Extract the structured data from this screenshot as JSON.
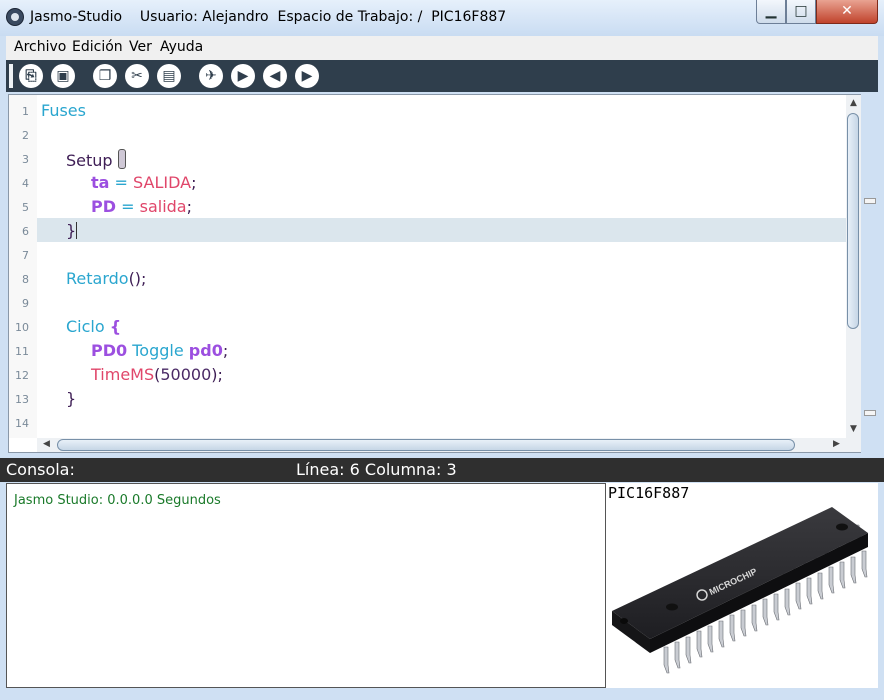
{
  "window": {
    "app_name": "Jasmo-Studio",
    "user_label": "Usuario: Alejandro",
    "workspace_label": "Espacio de Trabajo: /",
    "device": "PIC16F887",
    "controls": {
      "minimize": "▁",
      "maximize": "□",
      "close": "✕"
    }
  },
  "menu": [
    "Archivo",
    "Edición",
    "Ver",
    "Ayuda"
  ],
  "toolbar": [
    {
      "icon": "new-file-icon",
      "glyph": "⎘"
    },
    {
      "icon": "save-icon",
      "glyph": "▣"
    },
    {
      "icon": "copy-icon",
      "glyph": "❐"
    },
    {
      "icon": "cut-icon",
      "glyph": "✂"
    },
    {
      "icon": "paste-icon",
      "glyph": "▤"
    },
    {
      "icon": "airplane-icon",
      "glyph": "✈"
    },
    {
      "icon": "play-icon",
      "glyph": "▶"
    },
    {
      "icon": "arrow-left-icon",
      "glyph": "◀"
    },
    {
      "icon": "arrow-right-icon",
      "glyph": "▶"
    }
  ],
  "editor": {
    "line_numbers": [
      "1",
      "2",
      "3",
      "4",
      "5",
      "6",
      "7",
      "8",
      "9",
      "10",
      "11",
      "12",
      "13",
      "14"
    ],
    "current_line_index": 5,
    "lines": {
      "l1": {
        "word": "Fuses"
      },
      "l3": {
        "word": "Setup"
      },
      "l4": {
        "name": "ta",
        "op": "=",
        "value": "SALIDA",
        "end": ";"
      },
      "l5": {
        "name": "PD",
        "op": "=",
        "value": "salida",
        "end": ";"
      },
      "l6": {
        "brace": "}"
      },
      "l8": {
        "call": "Retardo",
        "paren": "()",
        "end": ";"
      },
      "l10": {
        "word": "Ciclo",
        "brace": "{"
      },
      "l11": {
        "pin": "PD0",
        "cmd": "Toggle",
        "arg": "pd0",
        "end": ";"
      },
      "l12": {
        "func": "TimeMS",
        "open": "(",
        "num": "50000",
        "close": ")",
        "end": ";"
      },
      "l13": {
        "brace": "}"
      }
    }
  },
  "scroll": {
    "up": "▲",
    "down": "▼",
    "left": "◀",
    "right": "▶"
  },
  "status": {
    "console_label": "Consola:",
    "position_text": "Línea: 6 Columna: 3"
  },
  "console": {
    "output": "Jasmo Studio: 0.0.0.0 Segundos"
  },
  "chip": {
    "label": "PIC16F887",
    "brand": "MICROCHIP"
  },
  "colors": {
    "keyword_cyan": "#2aa6cf",
    "keyword_purple": "#9c4fe0",
    "value_pink": "#e0466a",
    "console_green": "#1a7a2a",
    "toolbar_bg": "#2f3e4c"
  }
}
